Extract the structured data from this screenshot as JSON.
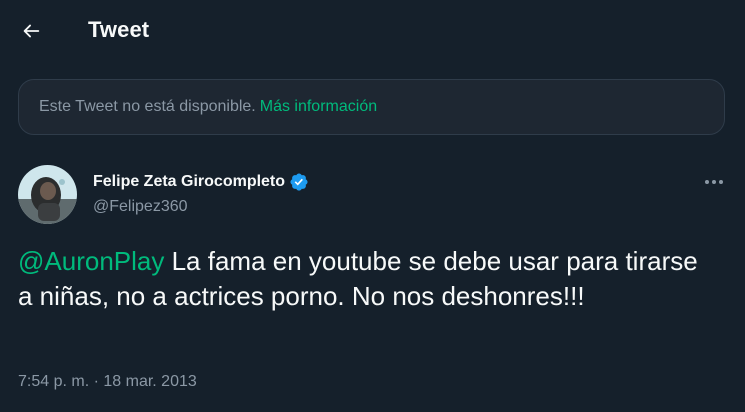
{
  "header": {
    "title": "Tweet",
    "back_icon": "arrow-left-icon"
  },
  "notice": {
    "text": "Este Tweet no está disponible.",
    "link": "Más información"
  },
  "author": {
    "name": "Felipe Zeta Girocompleto",
    "handle": "@Felipez360",
    "verified_icon": "verified-badge-icon"
  },
  "tweet": {
    "mention": "@AuronPlay",
    "text": " La fama en youtube se debe usar para tirarse a niñas, no a actrices porno. No nos deshonres!!!"
  },
  "meta": {
    "time": "7:54 p. m.",
    "separator": " · ",
    "date": "18 mar. 2013"
  },
  "colors": {
    "background": "#15202b",
    "accent": "#00ba7c",
    "secondary_text": "#8b98a5",
    "verified": "#1d9bf0"
  }
}
